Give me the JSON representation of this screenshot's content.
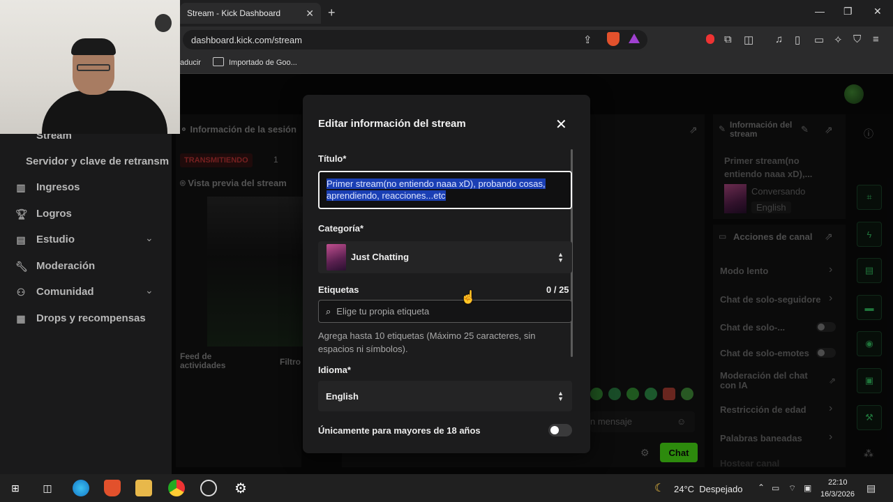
{
  "browser": {
    "tab_title": "Stream - Kick Dashboard",
    "tab_close": "✕",
    "new_tab": "+",
    "url": "dashboard.kick.com/stream",
    "bookmarks": {
      "translate_partial": "aducir",
      "folder": "Importado de Goo..."
    }
  },
  "sidebar": {
    "partial_top": "Stream",
    "items": [
      {
        "label": "Servidor y clave de retransm"
      },
      {
        "label": "Ingresos"
      },
      {
        "label": "Logros"
      },
      {
        "label": "Estudio"
      },
      {
        "label": "Moderación"
      },
      {
        "label": "Comunidad"
      },
      {
        "label": "Drops y recompensas"
      }
    ]
  },
  "session": {
    "title": "Información de la sesión",
    "status": "TRANSMITIENDO",
    "viewers": "1",
    "preview_title": "Vista previa del stream",
    "feed_title": "Feed de actividades",
    "filter": "Filtro"
  },
  "chat": {
    "placeholder": "n mensaje",
    "send": "Chat"
  },
  "modal": {
    "title": "Editar información del stream",
    "title_label": "Título*",
    "title_value": "Primer stream(no entiendo naaa xD), probando cosas, aprendiendo, reacciones...etc",
    "category_label": "Categoría*",
    "category_value": "Just Chatting",
    "tags_label": "Etiquetas",
    "tags_count": "0 / 25",
    "tags_placeholder": "Elige tu propia etiqueta",
    "tags_help": "Agrega hasta 10 etiquetas (Máximo 25 caracteres, sin espacios ni símbolos).",
    "language_label": "Idioma*",
    "language_value": "English",
    "adult_label": "Únicamente para mayores de 18 años",
    "adult_enabled": false
  },
  "stream_info": {
    "title": "Información del stream",
    "stream_title": "Primer stream(no entiendo naaa xD),...",
    "category": "Conversando",
    "language": "English"
  },
  "channel_actions": {
    "title": "Acciones de canal",
    "items": [
      "Modo lento",
      "Chat de solo-seguidore",
      "Chat de solo-...",
      "Chat de solo-emotes",
      "Moderación del chat con IA",
      "Restricción de edad",
      "Palabras baneadas",
      "Hostear canal"
    ]
  },
  "taskbar": {
    "weather": "24°C  Despejado",
    "time": "22:10",
    "date": "16/3/2026"
  },
  "colors": {
    "accent": "#53fc18",
    "selection": "#1a3fb4",
    "live_red": "#d33b3b"
  }
}
